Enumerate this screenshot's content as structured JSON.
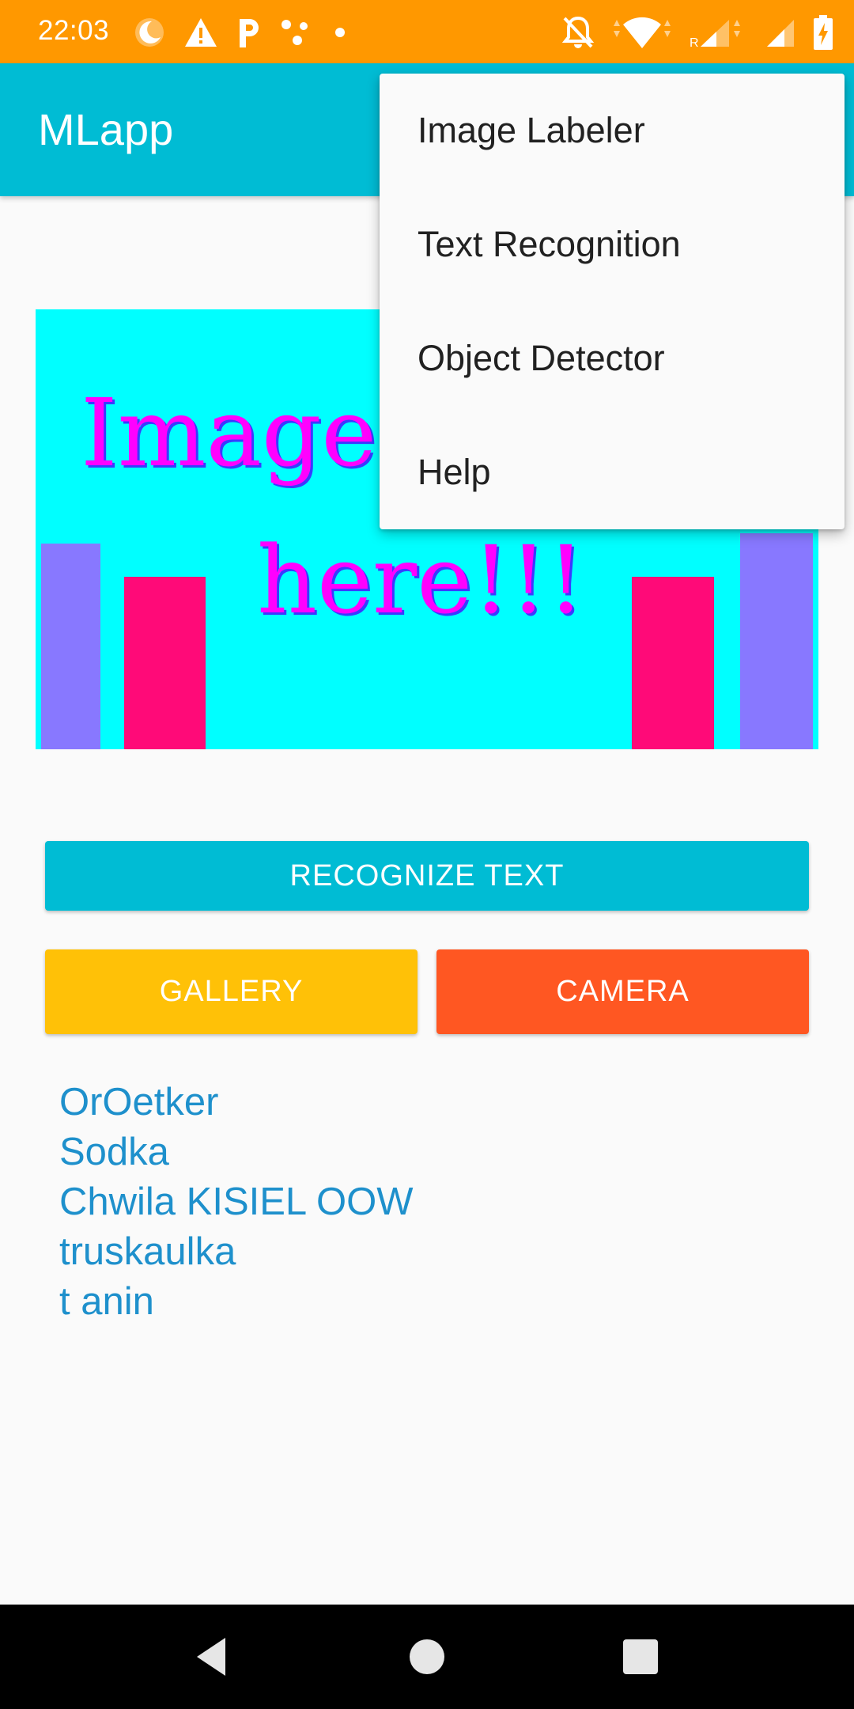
{
  "status_bar": {
    "time": "22:03",
    "left_icons": [
      "moon-icon",
      "warning-icon",
      "parking-p-icon",
      "dots-icon",
      "dot-icon"
    ],
    "right_icons": [
      "notifications-off-icon",
      "wifi-icon",
      "signal-roaming-icon",
      "signal-icon",
      "battery-charging-icon"
    ],
    "background": "#ff9800"
  },
  "app_bar": {
    "title": "MLapp",
    "background": "#00bcd4"
  },
  "preview_image": {
    "line1": "Image",
    "line2": "here!!!",
    "background": "#00ffff",
    "text_color": "#ff00ff",
    "bar_colors": [
      "#8878ff",
      "#ff0a78"
    ]
  },
  "buttons": {
    "recognize_label": "RECOGNIZE TEXT",
    "gallery_label": "GALLERY",
    "camera_label": "CAMERA",
    "recognize_color": "#00bcd4",
    "gallery_color": "#ffc107",
    "camera_color": "#ff5722"
  },
  "result": {
    "lines": [
      "OrOetker",
      "Sodka",
      "Chwila KISIEL OOW",
      "truskaulka",
      "t anin"
    ],
    "color": "#1e90cc"
  },
  "overflow_menu": {
    "items": [
      {
        "label": "Image Labeler"
      },
      {
        "label": "Text Recognition"
      },
      {
        "label": "Object Detector"
      },
      {
        "label": "Help"
      }
    ]
  },
  "nav_bar": {
    "icons": [
      "back-icon",
      "home-icon",
      "recents-icon"
    ]
  }
}
